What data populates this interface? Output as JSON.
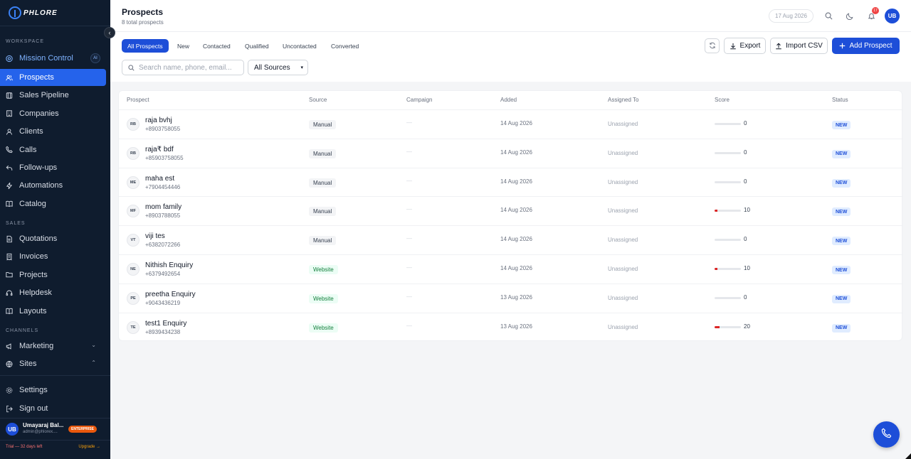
{
  "app": {
    "logo_text": "PHLORE"
  },
  "sidebar": {
    "workspace_label": "WORKSPACE",
    "mission_control": {
      "label": "Mission Control",
      "badge": "AI"
    },
    "workspace_items": [
      {
        "label": "Prospects",
        "icon": "users-icon"
      },
      {
        "label": "Sales Pipeline",
        "icon": "pipeline-icon"
      },
      {
        "label": "Companies",
        "icon": "building-icon"
      },
      {
        "label": "Clients",
        "icon": "user-icon"
      },
      {
        "label": "Calls",
        "icon": "phone-icon"
      },
      {
        "label": "Follow-ups",
        "icon": "reply-icon"
      },
      {
        "label": "Automations",
        "icon": "zap-icon"
      },
      {
        "label": "Catalog",
        "icon": "book-icon"
      }
    ],
    "sales_label": "SALES",
    "sales_items": [
      {
        "label": "Quotations",
        "icon": "document-icon"
      },
      {
        "label": "Invoices",
        "icon": "receipt-icon"
      },
      {
        "label": "Projects",
        "icon": "folder-icon"
      },
      {
        "label": "Helpdesk",
        "icon": "headset-icon"
      },
      {
        "label": "Layouts",
        "icon": "layout-icon"
      }
    ],
    "channels_label": "CHANNELS",
    "channel_items": [
      {
        "label": "Marketing",
        "icon": "megaphone-icon",
        "chevron": "⌄"
      },
      {
        "label": "Sites",
        "icon": "globe-icon",
        "chevron": "⌃"
      }
    ],
    "settings_label": "Settings",
    "signout_label": "Sign out",
    "user": {
      "initials": "UB",
      "name": "Umayaraj Bal...",
      "email": "admin@phlorex....",
      "plan": "ENTERPRISE"
    },
    "trial_text": "Trial — 32 days left",
    "upgrade_text": "Upgrade →"
  },
  "header": {
    "title": "Prospects",
    "subtitle": "8 total prospects",
    "date": "17 Aug 2026",
    "notifications": "17",
    "avatar_initials": "UB"
  },
  "toolbar": {
    "tabs": [
      "All Prospects",
      "New",
      "Contacted",
      "Qualified",
      "Uncontacted",
      "Converted"
    ],
    "active_tab": "All Prospects",
    "search_placeholder": "Search name, phone, email...",
    "source_filter": "All Sources",
    "export_label": "Export",
    "import_label": "Import CSV",
    "add_label": "Add Prospect"
  },
  "table": {
    "columns": [
      "Prospect",
      "Source",
      "Campaign",
      "Added",
      "Assigned To",
      "Score",
      "Status"
    ],
    "rows": [
      {
        "initials": "RB",
        "name": "raja bvhj",
        "phone": "+8903758055",
        "source": "Manual",
        "campaign": "—",
        "added": "14 Aug 2026",
        "assigned": "Unassigned",
        "score": 0,
        "status": "NEW"
      },
      {
        "initials": "RB",
        "name": "raja₹ bdf",
        "phone": "+85903758055",
        "source": "Manual",
        "campaign": "—",
        "added": "14 Aug 2026",
        "assigned": "Unassigned",
        "score": 0,
        "status": "NEW"
      },
      {
        "initials": "ME",
        "name": "maha est",
        "phone": "+7904454446",
        "source": "Manual",
        "campaign": "—",
        "added": "14 Aug 2026",
        "assigned": "Unassigned",
        "score": 0,
        "status": "NEW"
      },
      {
        "initials": "MF",
        "name": "mom family",
        "phone": "+8903788055",
        "source": "Manual",
        "campaign": "—",
        "added": "14 Aug 2026",
        "assigned": "Unassigned",
        "score": 10,
        "status": "NEW"
      },
      {
        "initials": "VT",
        "name": "viji tes",
        "phone": "+6382072266",
        "source": "Manual",
        "campaign": "—",
        "added": "14 Aug 2026",
        "assigned": "Unassigned",
        "score": 0,
        "status": "NEW"
      },
      {
        "initials": "NE",
        "name": "Nithish Enquiry",
        "phone": "+6379492654",
        "source": "Website",
        "campaign": "—",
        "added": "14 Aug 2026",
        "assigned": "Unassigned",
        "score": 10,
        "status": "NEW"
      },
      {
        "initials": "PE",
        "name": "preetha Enquiry",
        "phone": "+9043436219",
        "source": "Website",
        "campaign": "—",
        "added": "13 Aug 2026",
        "assigned": "Unassigned",
        "score": 0,
        "status": "NEW"
      },
      {
        "initials": "TE",
        "name": "test1 Enquiry",
        "phone": "+8939434238",
        "source": "Website",
        "campaign": "—",
        "added": "13 Aug 2026",
        "assigned": "Unassigned",
        "score": 20,
        "status": "NEW"
      }
    ]
  },
  "colors": {
    "primary": "#1d4ed8",
    "sidebar_bg": "#0f1c2e",
    "score_fill": "#dc2626"
  }
}
